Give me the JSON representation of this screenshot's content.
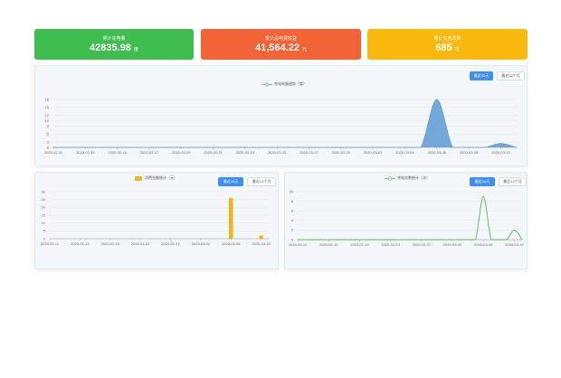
{
  "cards": [
    {
      "label": "累计充电量",
      "value": "42835.98",
      "unit": "度",
      "color": "#3fbd4f"
    },
    {
      "label": "累计总电费收益",
      "value": "41,564.22",
      "unit": "元",
      "color": "#f26436"
    },
    {
      "label": "累计充电次数",
      "value": "685",
      "unit": "次",
      "color": "#f9b90e"
    }
  ],
  "buttons": {
    "recent30": "最近30天",
    "recent12": "最近12个月"
  },
  "chart_data": [
    {
      "type": "area",
      "title": "",
      "series": [
        {
          "name": "充电电量趋势（度）",
          "color": "#5b9bd5"
        }
      ],
      "x_ticks": [
        "2020-02-11",
        "2020-02-13",
        "2020-02-15",
        "2020-02-17",
        "2020-02-19",
        "2020-02-21",
        "2020-02-23",
        "2020-02-25",
        "2020-02-27",
        "2020-02-29",
        "2020-03-02",
        "2020-03-04",
        "2020-03-06",
        "2020-03-08",
        "2020-03-10"
      ],
      "y_ticks": [
        "0",
        "2",
        "5",
        "8",
        "10",
        "12",
        "15",
        "18"
      ],
      "ylim": [
        0,
        18
      ],
      "x": [
        "2020-02-11",
        "2020-02-12",
        "2020-02-13",
        "2020-02-14",
        "2020-02-15",
        "2020-02-16",
        "2020-02-17",
        "2020-02-18",
        "2020-02-19",
        "2020-02-20",
        "2020-02-21",
        "2020-02-22",
        "2020-02-23",
        "2020-02-24",
        "2020-02-25",
        "2020-02-26",
        "2020-02-27",
        "2020-02-28",
        "2020-02-29",
        "2020-03-01",
        "2020-03-02",
        "2020-03-03",
        "2020-03-04",
        "2020-03-05",
        "2020-03-06",
        "2020-03-07",
        "2020-03-08",
        "2020-03-09",
        "2020-03-10",
        "2020-03-11"
      ],
      "values": [
        0,
        0,
        0,
        0,
        0,
        0,
        0,
        0,
        0,
        0,
        0,
        0,
        0,
        0,
        0,
        0,
        0,
        0,
        0,
        0,
        0,
        0,
        0,
        0,
        18,
        0,
        0,
        0,
        1.5,
        0
      ]
    },
    {
      "type": "bar",
      "title": "",
      "series": [
        {
          "name": "消费金额统计（元）",
          "color": "#f0b41c"
        }
      ],
      "x_ticks": [
        "2020-02-11",
        "2020-02-15",
        "2020-02-19",
        "2020-02-23",
        "2020-02-27",
        "2020-03-02",
        "2020-03-06",
        "2020-03-10"
      ],
      "y_ticks": [
        "0",
        "5",
        "10",
        "15",
        "20",
        "25",
        "30"
      ],
      "ylim": [
        0,
        30
      ],
      "x": [
        "2020-02-11",
        "2020-02-12",
        "2020-02-13",
        "2020-02-14",
        "2020-02-15",
        "2020-02-16",
        "2020-02-17",
        "2020-02-18",
        "2020-02-19",
        "2020-02-20",
        "2020-02-21",
        "2020-02-22",
        "2020-02-23",
        "2020-02-24",
        "2020-02-25",
        "2020-02-26",
        "2020-02-27",
        "2020-02-28",
        "2020-02-29",
        "2020-03-01",
        "2020-03-02",
        "2020-03-03",
        "2020-03-04",
        "2020-03-05",
        "2020-03-06",
        "2020-03-07",
        "2020-03-08",
        "2020-03-09",
        "2020-03-10",
        "2020-03-11"
      ],
      "values": [
        0,
        0,
        0,
        0,
        0,
        0,
        0,
        0,
        0,
        0,
        0,
        0,
        0,
        0,
        0,
        0,
        0,
        0,
        0,
        0,
        0,
        0,
        0,
        0,
        26,
        0,
        0,
        0,
        2,
        0
      ]
    },
    {
      "type": "line",
      "title": "",
      "series": [
        {
          "name": "充电次数统计（次）",
          "color": "#59b55b"
        }
      ],
      "x_ticks": [
        "2020-02-11",
        "2020-02-15",
        "2020-02-19",
        "2020-02-23",
        "2020-02-27",
        "2020-03-02",
        "2020-03-06",
        "2020-03-10"
      ],
      "y_ticks": [
        "0",
        "2",
        "4",
        "6",
        "8",
        "10"
      ],
      "ylim": [
        0,
        10
      ],
      "x": [
        "2020-02-11",
        "2020-02-12",
        "2020-02-13",
        "2020-02-14",
        "2020-02-15",
        "2020-02-16",
        "2020-02-17",
        "2020-02-18",
        "2020-02-19",
        "2020-02-20",
        "2020-02-21",
        "2020-02-22",
        "2020-02-23",
        "2020-02-24",
        "2020-02-25",
        "2020-02-26",
        "2020-02-27",
        "2020-02-28",
        "2020-02-29",
        "2020-03-01",
        "2020-03-02",
        "2020-03-03",
        "2020-03-04",
        "2020-03-05",
        "2020-03-06",
        "2020-03-07",
        "2020-03-08",
        "2020-03-09",
        "2020-03-10",
        "2020-03-11"
      ],
      "values": [
        0,
        0,
        0,
        0,
        0,
        0,
        0,
        0,
        0,
        0,
        0,
        0,
        0,
        0,
        0,
        0,
        0,
        0,
        0,
        0,
        0,
        0,
        0,
        0,
        9,
        0,
        0,
        0,
        2,
        0
      ]
    }
  ]
}
